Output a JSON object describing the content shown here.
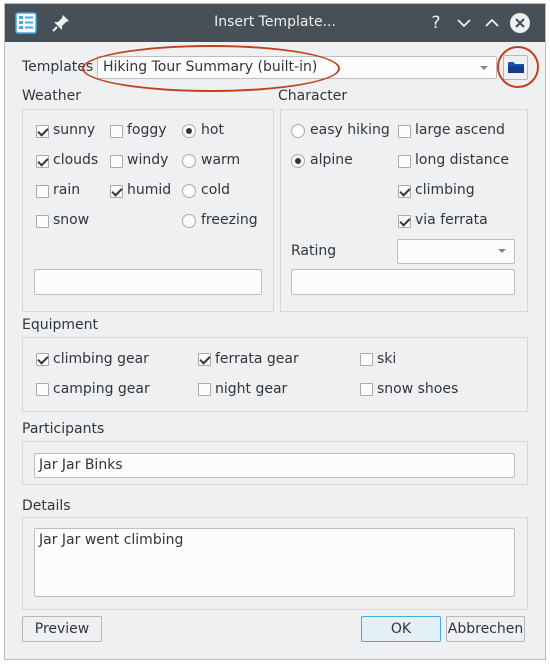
{
  "window": {
    "title": "Insert Template...",
    "help_glyph": "?",
    "minimize_glyph": "⌄",
    "maximize_glyph": "⌃",
    "close_glyph": "✕"
  },
  "templates": {
    "label": "Templates",
    "selected": "Hiking Tour Summary (built-in)"
  },
  "weather": {
    "title": "Weather",
    "options": [
      {
        "label": "sunny",
        "type": "checkbox",
        "checked": true
      },
      {
        "label": "foggy",
        "type": "checkbox",
        "checked": false
      },
      {
        "label": "hot",
        "type": "radio",
        "checked": true
      },
      {
        "label": "clouds",
        "type": "checkbox",
        "checked": true
      },
      {
        "label": "windy",
        "type": "checkbox",
        "checked": false
      },
      {
        "label": "warm",
        "type": "radio",
        "checked": false
      },
      {
        "label": "rain",
        "type": "checkbox",
        "checked": false
      },
      {
        "label": "humid",
        "type": "checkbox",
        "checked": true
      },
      {
        "label": "cold",
        "type": "radio",
        "checked": false
      },
      {
        "label": "snow",
        "type": "checkbox",
        "checked": false
      },
      {
        "label": "freezing",
        "type": "radio",
        "checked": false
      }
    ],
    "text_value": ""
  },
  "character": {
    "title": "Character",
    "options": [
      {
        "label": "easy hiking",
        "type": "radio",
        "checked": false
      },
      {
        "label": "large ascend",
        "type": "checkbox",
        "checked": false
      },
      {
        "label": "alpine",
        "type": "radio",
        "checked": true
      },
      {
        "label": "long distance",
        "type": "checkbox",
        "checked": false
      },
      {
        "label": "climbing",
        "type": "checkbox",
        "checked": true
      },
      {
        "label": "via ferrata",
        "type": "checkbox",
        "checked": true
      }
    ],
    "rating_label": "Rating",
    "rating_value": "",
    "text_value": ""
  },
  "equipment": {
    "title": "Equipment",
    "options": [
      {
        "label": "climbing gear",
        "checked": true
      },
      {
        "label": "ferrata gear",
        "checked": true
      },
      {
        "label": "ski",
        "checked": false
      },
      {
        "label": "camping gear",
        "checked": false
      },
      {
        "label": "night gear",
        "checked": false
      },
      {
        "label": "snow shoes",
        "checked": false
      }
    ]
  },
  "participants": {
    "title": "Participants",
    "value": "Jar Jar Binks"
  },
  "details": {
    "title": "Details",
    "value": "Jar Jar went climbing"
  },
  "buttons": {
    "preview": "Preview",
    "ok": "OK",
    "cancel": "Abbrechen"
  },
  "colors": {
    "titlebar": "#475057",
    "window_bg": "#eff0f1",
    "accent": "#3daee9",
    "annotation": "#c2401a",
    "folder_icon": "#1a4fb3"
  }
}
